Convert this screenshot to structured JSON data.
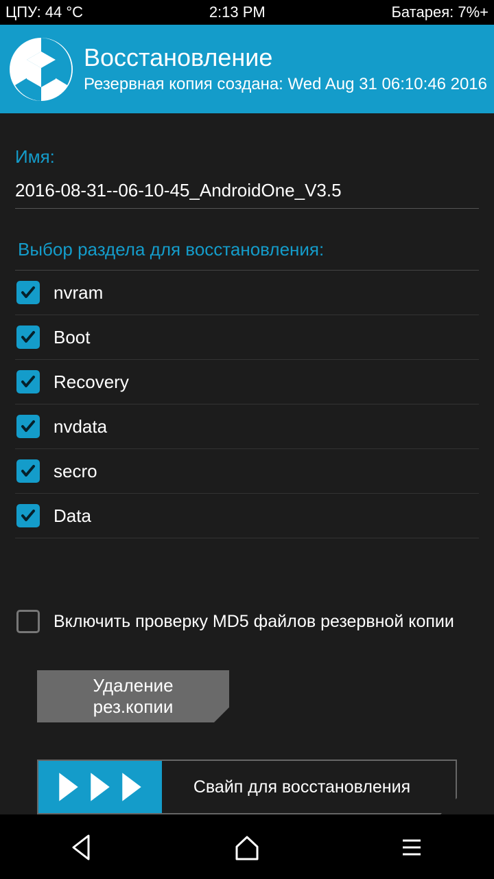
{
  "status": {
    "cpu": "ЦПУ: 44 °C",
    "time": "2:13 PM",
    "battery": "Батарея: 7%+"
  },
  "header": {
    "title": "Восстановление",
    "subtitle": "Резервная копия создана: Wed Aug 31 06:10:46 2016"
  },
  "name": {
    "label": "Имя:",
    "value": "2016-08-31--06-10-45_AndroidOne_V3.5"
  },
  "partitions": {
    "header": "Выбор раздела для восстановления:",
    "items": [
      {
        "label": "nvram",
        "checked": true
      },
      {
        "label": "Boot",
        "checked": true
      },
      {
        "label": "Recovery",
        "checked": true
      },
      {
        "label": "nvdata",
        "checked": true
      },
      {
        "label": "secro",
        "checked": true
      },
      {
        "label": "Data",
        "checked": true
      }
    ]
  },
  "md5": {
    "label": "Включить проверку MD5 файлов резервной копии",
    "checked": false
  },
  "delete_button": "Удаление рез.копии",
  "swipe_label": "Свайп для восстановления"
}
